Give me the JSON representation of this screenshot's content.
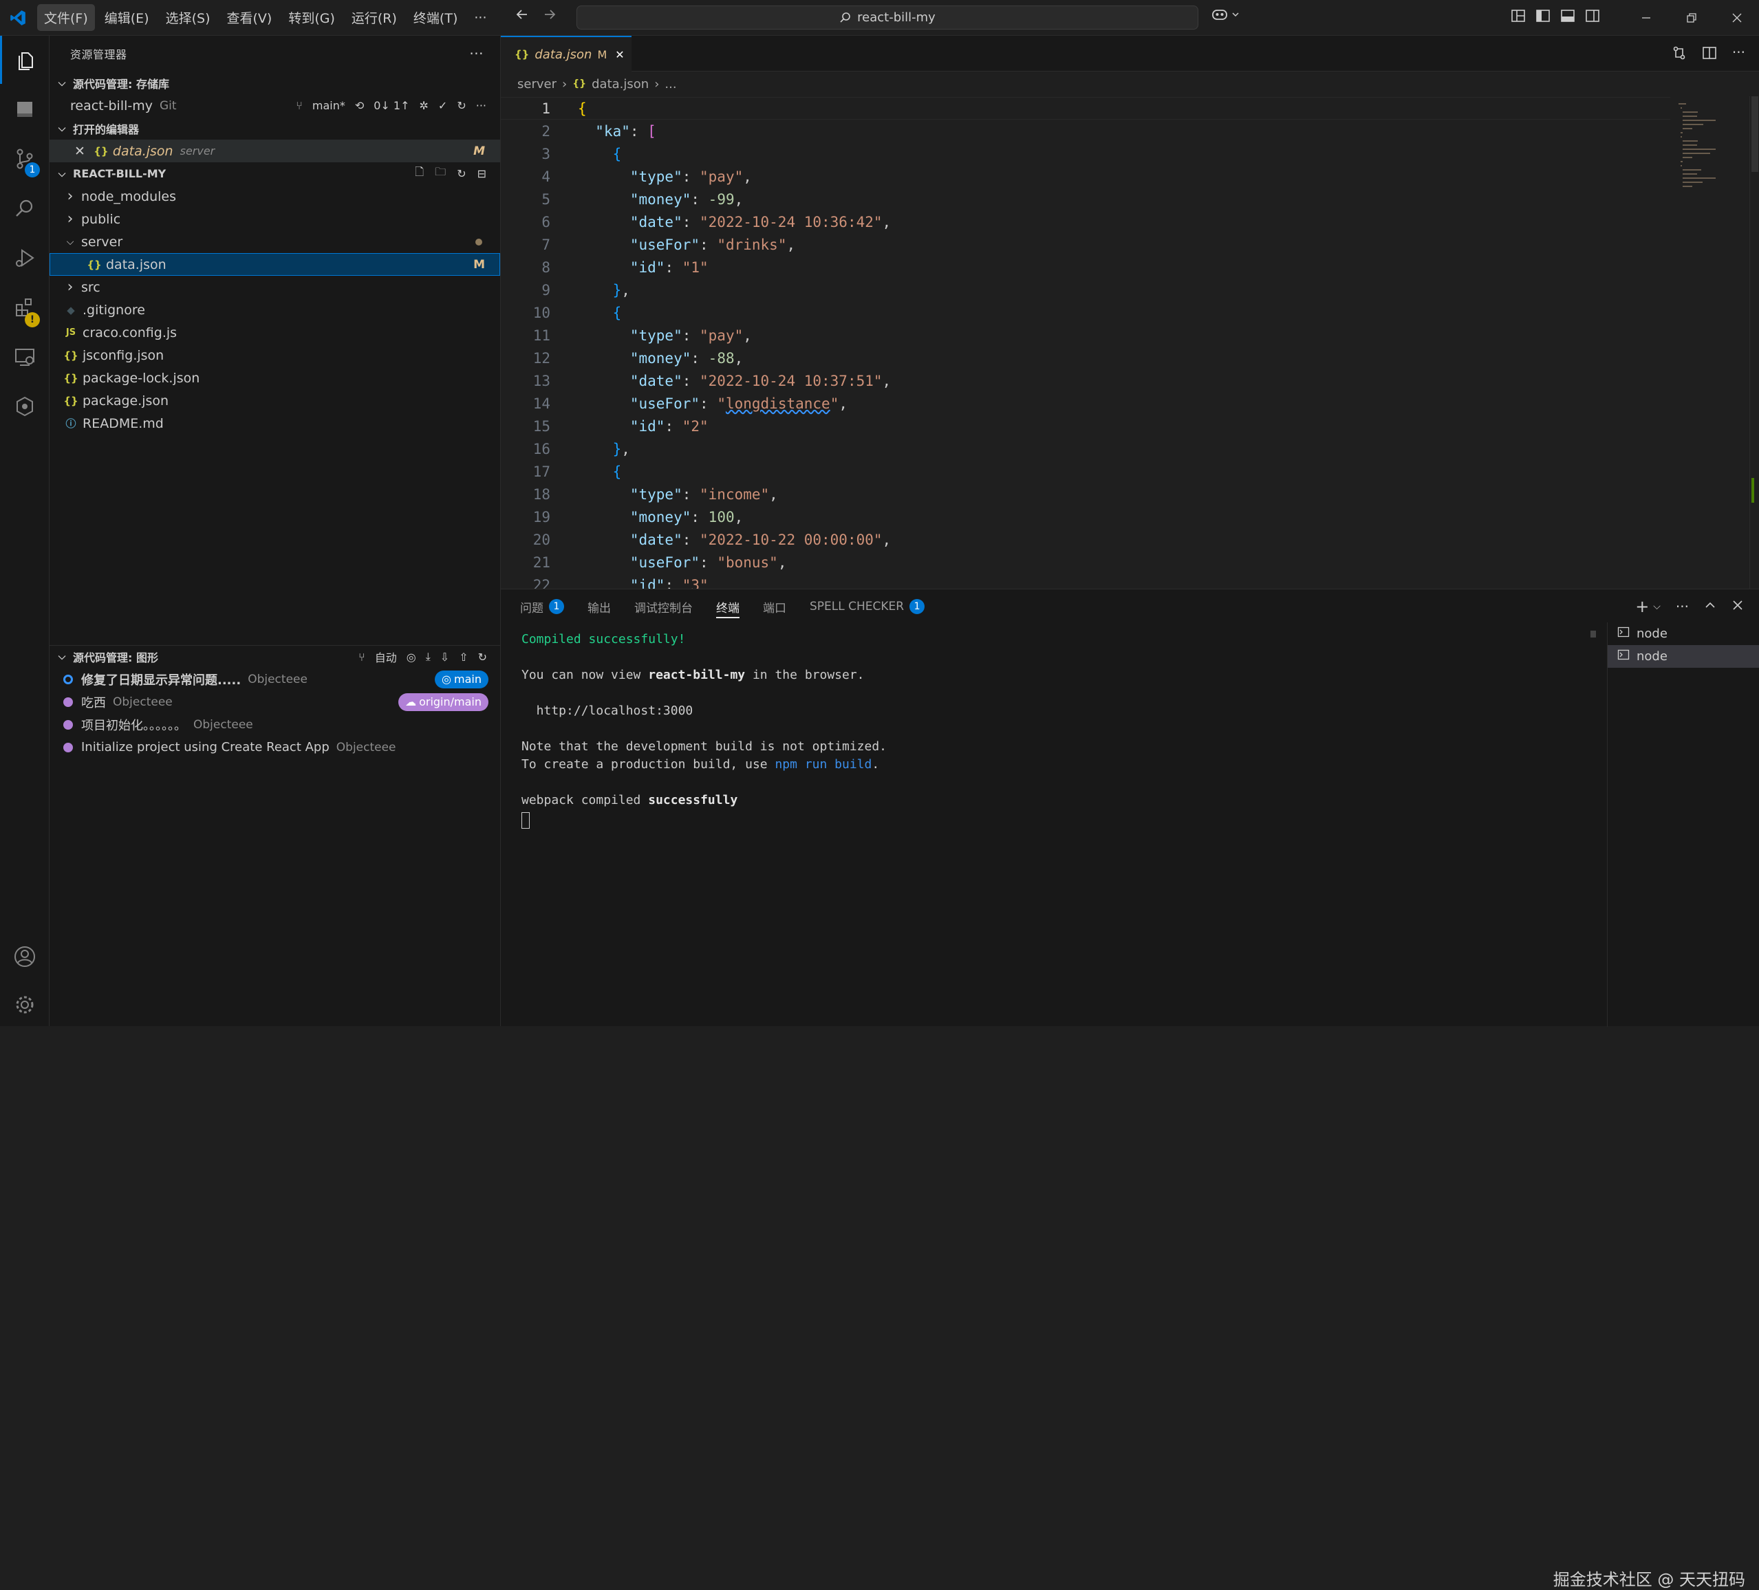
{
  "menu": [
    "文件(F)",
    "编辑(E)",
    "选择(S)",
    "查看(V)",
    "转到(G)",
    "运行(R)",
    "终端(T)",
    "···"
  ],
  "command_center": {
    "text": "react-bill-my"
  },
  "sidebar": {
    "title": "资源管理器",
    "scm_repos": {
      "header": "源代码管理: 存储库",
      "repo_name": "react-bill-my",
      "repo_type": "Git",
      "branch": "main*",
      "sync": "0↓ 1↑"
    },
    "open_editors": {
      "header": "打开的编辑器",
      "items": [
        {
          "name": "data.json",
          "folder": "server",
          "status": "M"
        }
      ]
    },
    "explorer": {
      "header": "REACT-BILL-MY",
      "items": [
        {
          "name": "node_modules",
          "kind": "folder",
          "indent": 0
        },
        {
          "name": "public",
          "kind": "folder",
          "indent": 0
        },
        {
          "name": "server",
          "kind": "folder-open",
          "indent": 0
        },
        {
          "name": "data.json",
          "kind": "json",
          "indent": 1,
          "status": "M"
        },
        {
          "name": "src",
          "kind": "folder",
          "indent": 0
        },
        {
          "name": ".gitignore",
          "kind": "git",
          "indent": 0
        },
        {
          "name": "craco.config.js",
          "kind": "js",
          "indent": 0
        },
        {
          "name": "jsconfig.json",
          "kind": "json",
          "indent": 0
        },
        {
          "name": "package-lock.json",
          "kind": "json",
          "indent": 0
        },
        {
          "name": "package.json",
          "kind": "json",
          "indent": 0
        },
        {
          "name": "README.md",
          "kind": "info",
          "indent": 0
        }
      ]
    },
    "scm_graph": {
      "header": "源代码管理: 图形",
      "auto_label": "自动",
      "commits": [
        {
          "message": "修复了日期显示异常问题.....",
          "author": "Objecteee",
          "tag": "main",
          "tag_color": "#0078d4"
        },
        {
          "message": "吃西",
          "author": "Objecteee",
          "tag": "origin/main",
          "tag_color": "#b180d7"
        },
        {
          "message": "项目初始化。。。。。。",
          "author": "Objecteee",
          "tag": "",
          "tag_color": ""
        },
        {
          "message": "Initialize project using Create React App",
          "author": "Objecteee",
          "tag": "",
          "tag_color": ""
        }
      ]
    }
  },
  "editor": {
    "tab": {
      "name": "data.json",
      "status": "M"
    },
    "breadcrumb": [
      "server",
      "data.json",
      "..."
    ],
    "lines": [
      [
        [
          "{",
          "b1"
        ]
      ],
      [
        [
          "  ",
          ""
        ],
        [
          "\"ka\"",
          "k"
        ],
        [
          ": ",
          "p"
        ],
        [
          "[",
          "b2"
        ]
      ],
      [
        [
          "    ",
          ""
        ],
        [
          "{",
          "b3"
        ]
      ],
      [
        [
          "      ",
          ""
        ],
        [
          "\"type\"",
          "k"
        ],
        [
          ": ",
          "p"
        ],
        [
          "\"pay\"",
          "s"
        ],
        [
          ",",
          "p"
        ]
      ],
      [
        [
          "      ",
          ""
        ],
        [
          "\"money\"",
          "k"
        ],
        [
          ": ",
          "p"
        ],
        [
          "-99",
          "n"
        ],
        [
          ",",
          "p"
        ]
      ],
      [
        [
          "      ",
          ""
        ],
        [
          "\"date\"",
          "k"
        ],
        [
          ": ",
          "p"
        ],
        [
          "\"2022-10-24 10:36:42\"",
          "s"
        ],
        [
          ",",
          "p"
        ]
      ],
      [
        [
          "      ",
          ""
        ],
        [
          "\"useFor\"",
          "k"
        ],
        [
          ": ",
          "p"
        ],
        [
          "\"drinks\"",
          "s"
        ],
        [
          ",",
          "p"
        ]
      ],
      [
        [
          "      ",
          ""
        ],
        [
          "\"id\"",
          "k"
        ],
        [
          ": ",
          "p"
        ],
        [
          "\"1\"",
          "s"
        ]
      ],
      [
        [
          "    ",
          ""
        ],
        [
          "}",
          "b3"
        ],
        [
          ",",
          "p"
        ]
      ],
      [
        [
          "    ",
          ""
        ],
        [
          "{",
          "b3"
        ]
      ],
      [
        [
          "      ",
          ""
        ],
        [
          "\"type\"",
          "k"
        ],
        [
          ": ",
          "p"
        ],
        [
          "\"pay\"",
          "s"
        ],
        [
          ",",
          "p"
        ]
      ],
      [
        [
          "      ",
          ""
        ],
        [
          "\"money\"",
          "k"
        ],
        [
          ": ",
          "p"
        ],
        [
          "-88",
          "n"
        ],
        [
          ",",
          "p"
        ]
      ],
      [
        [
          "      ",
          ""
        ],
        [
          "\"date\"",
          "k"
        ],
        [
          ": ",
          "p"
        ],
        [
          "\"2022-10-24 10:37:51\"",
          "s"
        ],
        [
          ",",
          "p"
        ]
      ],
      [
        [
          "      ",
          ""
        ],
        [
          "\"useFor\"",
          "k"
        ],
        [
          ": ",
          "p"
        ],
        [
          "\"",
          "s"
        ],
        [
          "longdistance",
          "s squig"
        ],
        [
          "\"",
          "s"
        ],
        [
          ",",
          "p"
        ]
      ],
      [
        [
          "      ",
          ""
        ],
        [
          "\"id\"",
          "k"
        ],
        [
          ": ",
          "p"
        ],
        [
          "\"2\"",
          "s"
        ]
      ],
      [
        [
          "    ",
          ""
        ],
        [
          "}",
          "b3"
        ],
        [
          ",",
          "p"
        ]
      ],
      [
        [
          "    ",
          ""
        ],
        [
          "{",
          "b3"
        ]
      ],
      [
        [
          "      ",
          ""
        ],
        [
          "\"type\"",
          "k"
        ],
        [
          ": ",
          "p"
        ],
        [
          "\"income\"",
          "s"
        ],
        [
          ",",
          "p"
        ]
      ],
      [
        [
          "      ",
          ""
        ],
        [
          "\"money\"",
          "k"
        ],
        [
          ": ",
          "p"
        ],
        [
          "100",
          "n"
        ],
        [
          ",",
          "p"
        ]
      ],
      [
        [
          "      ",
          ""
        ],
        [
          "\"date\"",
          "k"
        ],
        [
          ": ",
          "p"
        ],
        [
          "\"2022-10-22 00:00:00\"",
          "s"
        ],
        [
          ",",
          "p"
        ]
      ],
      [
        [
          "      ",
          ""
        ],
        [
          "\"useFor\"",
          "k"
        ],
        [
          ": ",
          "p"
        ],
        [
          "\"bonus\"",
          "s"
        ],
        [
          ",",
          "p"
        ]
      ],
      [
        [
          "      ",
          ""
        ],
        [
          "\"id\"",
          "k"
        ],
        [
          ": ",
          "p"
        ],
        [
          "\"3\"",
          "s"
        ]
      ]
    ]
  },
  "panel": {
    "tabs": [
      {
        "label": "问题",
        "badge": "1"
      },
      {
        "label": "输出",
        "badge": ""
      },
      {
        "label": "调试控制台",
        "badge": ""
      },
      {
        "label": "终端",
        "badge": "",
        "active": true
      },
      {
        "label": "端口",
        "badge": ""
      },
      {
        "label": "SPELL CHECKER",
        "badge": "1"
      }
    ],
    "terminal_lines": [
      [
        [
          "Compiled successfully!",
          "green"
        ]
      ],
      [
        [
          "",
          ""
        ]
      ],
      [
        [
          "You can now view ",
          ""
        ],
        [
          "react-bill-my",
          "bold"
        ],
        [
          " in the browser.",
          ""
        ]
      ],
      [
        [
          "",
          ""
        ]
      ],
      [
        [
          "  http://localhost:3000",
          ""
        ]
      ],
      [
        [
          "",
          ""
        ]
      ],
      [
        [
          "Note that the development build is not optimized.",
          ""
        ]
      ],
      [
        [
          "To create a production build, use ",
          ""
        ],
        [
          "npm run build",
          "blue"
        ],
        [
          ".",
          ""
        ]
      ],
      [
        [
          "",
          ""
        ]
      ],
      [
        [
          "webpack compiled ",
          ""
        ],
        [
          "successfully",
          "green bold"
        ]
      ]
    ],
    "terminals": [
      "node",
      "node"
    ]
  },
  "watermark": "掘金技术社区 @ 天天扭码",
  "colors": {
    "accent": "#0078d4",
    "modified": "#e2c08d",
    "graph_purple": "#b180d7"
  }
}
